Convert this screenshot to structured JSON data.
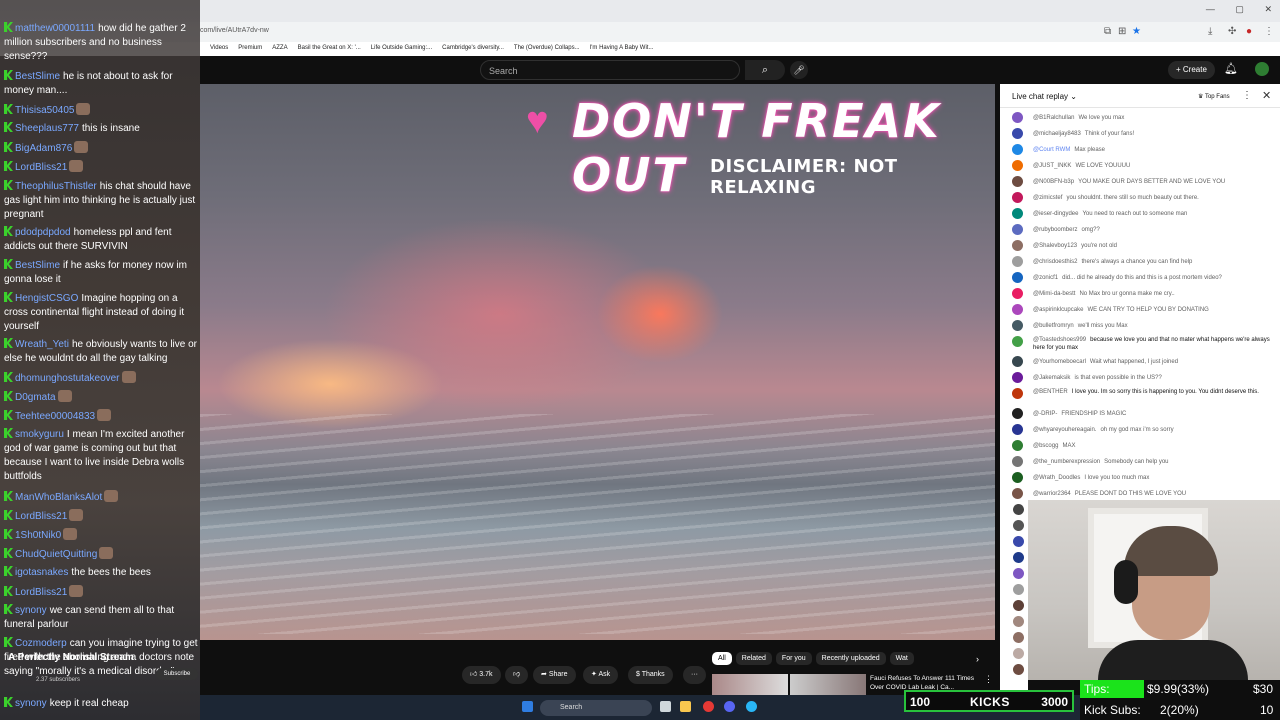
{
  "browser": {
    "url": "com/live/AUtrA7dv-nw",
    "bookmarks": [
      "Videos",
      "Premium",
      "AZZA",
      "Basil the Great on X: '...",
      "Life Outside Gaming:...",
      "Cambridge's diversity...",
      "The (Overdue) Collaps...",
      "I'm Having A Baby Wit..."
    ]
  },
  "youtube": {
    "search_placeholder": "Search",
    "create_label": "Create",
    "channel_title": "A Perfectly Normal Stream",
    "subscribers": "2.37 subscribers",
    "subscribe_label": "Subscribe",
    "like_count": "3.7k",
    "share_label": "Share",
    "ask_label": "Ask",
    "thanks_label": "Thanks",
    "filter_tabs": [
      "All",
      "Related",
      "For you",
      "Recently uploaded",
      "Wat"
    ],
    "recommended_title": "Fauci Refuses To Answer 111 Times Over COVID Lab Leak | Ca..."
  },
  "video": {
    "overlay_title": "DON'T FREAK OUT",
    "disclaimer": "DISCLAIMER: NOT RELAXING"
  },
  "live_chat": {
    "title": "Live chat replay",
    "top_fans": "Top Fans",
    "messages": [
      {
        "author": "@B1Ralchullan",
        "text": "We love you max",
        "color": "#7e57c2"
      },
      {
        "author": "@michaeljay8483",
        "text": "Think of your fans!",
        "color": "#3949ab"
      },
      {
        "author": "@Court RWM",
        "text": "Max please",
        "color": "#1e88e5",
        "mod": true
      },
      {
        "author": "@JUST_INKK",
        "text": "WE LOVE YOUUUU",
        "color": "#ef6c00"
      },
      {
        "author": "@N00BFN-b3p",
        "text": "YOU MAKE OUR DAYS BETTER AND WE LOVE YOU",
        "color": "#6d4c41"
      },
      {
        "author": "@zimicstef",
        "text": "you shouldnt. there still so much beauty out there.",
        "color": "#c2185b"
      },
      {
        "author": "@ieser-dingydee",
        "text": "You need to reach out to someone man",
        "color": "#00897b"
      },
      {
        "author": "@rubyboomberz",
        "text": "omg??",
        "color": "#5c6bc0"
      },
      {
        "author": "@Shalevboy123",
        "text": "you're not old",
        "color": "#8d6e63"
      },
      {
        "author": "@chrisdoesthis2",
        "text": "there's always a chance you can find help",
        "color": "#9e9e9e"
      },
      {
        "author": "@zonicf1",
        "text": "did... did he already do this and this is a post mortem video?",
        "color": "#1565c0"
      },
      {
        "author": "@Mimi-da-bestt",
        "text": "No Max bro ur gonna make me cry..",
        "color": "#e91e63"
      },
      {
        "author": "@aspirinklcupcake",
        "text": "WE CAN TRY TO HELP YOU BY DONATING",
        "color": "#ab47bc"
      },
      {
        "author": "@bulletfromryn",
        "text": "we'll miss you Max",
        "color": "#455a64"
      },
      {
        "author": "@Toastedshoes999",
        "text": "because we love you and that no mater what happens we're always here for you max",
        "color": "#43a047",
        "wrap": true
      },
      {
        "author": "@Yourhomeboecarl",
        "text": "Wait what happened, I just joined",
        "color": "#37474f"
      },
      {
        "author": "@Jakemaksik",
        "text": "is that even possible in the US??",
        "color": "#6a1b9a"
      },
      {
        "author": "@BENTHER",
        "text": "I love you. Im so sorry this is happening to you. You didnt deserve this.",
        "color": "#bf360c",
        "wrap": true
      },
      {
        "author": "@-DRIP-",
        "text": "FRIENDSHIP IS MAGIC",
        "color": "#212121"
      },
      {
        "author": "@whyareyouhereagain.",
        "text": "oh my god max i'm so sorry",
        "color": "#283593"
      },
      {
        "author": "@bscogg",
        "text": "MAX",
        "color": "#2e7d32"
      },
      {
        "author": "@the_numberexpression",
        "text": "Somebody can help you",
        "color": "#757575"
      },
      {
        "author": "@Wrath_Doodles",
        "text": "I love you too much max",
        "color": "#1b5e20"
      },
      {
        "author": "@warrior2364",
        "text": "PLEASE DONT DO THIS WE LOVE YOU",
        "color": "#795548"
      }
    ]
  },
  "stream_chat": {
    "messages": [
      {
        "user": "matthew00001111",
        "text": "how did he gather 2 million subscribers and no business sense???"
      },
      {
        "user": "BestSlime",
        "text": "he is not about to ask for money man...."
      },
      {
        "user": "Thisisa50405",
        "text": "",
        "emote": true
      },
      {
        "user": "Sheeplaus777",
        "text": "this is insane"
      },
      {
        "user": "BigAdam876",
        "text": "",
        "emote": true
      },
      {
        "user": "LordBliss21",
        "text": "",
        "emote": true
      },
      {
        "user": "TheophilusThistler",
        "text": "his chat should have gas light him into thinking he is actually just pregnant"
      },
      {
        "user": "pdodpdpdod",
        "text": "homeless ppl and fent addicts out there SURVIVIN"
      },
      {
        "user": "BestSlime",
        "text": "if he asks for money now im gonna lose it"
      },
      {
        "user": "HengistCSGO",
        "text": "Imagine hopping on a cross continental flight instead of doing it yourself"
      },
      {
        "user": "Wreath_Yeti",
        "text": "he obviously wants to live or else he wouldnt do all the gay talking"
      },
      {
        "user": "dhomunghostutakeover",
        "text": "",
        "emote": true
      },
      {
        "user": "D0gmata",
        "text": "",
        "emote": true
      },
      {
        "user": "Teehtee00004833",
        "text": "",
        "emote": true
      },
      {
        "user": "smokyguru",
        "text": "I mean I'm excited another god of war game is coming out but that because I want to live inside Debra wolls buttfolds"
      },
      {
        "user": "ManWhoBlanksAlot",
        "text": "",
        "emote": true
      },
      {
        "user": "LordBliss21",
        "text": "",
        "emote": true
      },
      {
        "user": "1Sh0tNik0",
        "text": "",
        "emote": true
      },
      {
        "user": "ChudQuietQuitting",
        "text": "",
        "emote": true
      },
      {
        "user": "igotasnakes",
        "text": "the bees the bees"
      },
      {
        "user": "LordBliss21",
        "text": "",
        "emote": true
      },
      {
        "user": "synony",
        "text": "we can send them all to that funeral parlour"
      },
      {
        "user": "Cozmoderp",
        "text": "can you imagine trying to get fired with the abolishing and a doctors note saying \"morally it's a medical disorder\""
      },
      {
        "user": "synony",
        "text": "keep it real cheap"
      }
    ]
  },
  "stats": {
    "kicks_left": "100",
    "kicks_label": "KICKS",
    "kicks_right": "3000",
    "tips_label": "Tips:",
    "tips_value": "$9.99(33%)",
    "tips_goal": "$30",
    "kick_subs_label": "Kick Subs:",
    "kick_subs_value": "2(20%)",
    "kick_subs_goal": "10"
  },
  "taskbar": {
    "search_label": "Search"
  }
}
